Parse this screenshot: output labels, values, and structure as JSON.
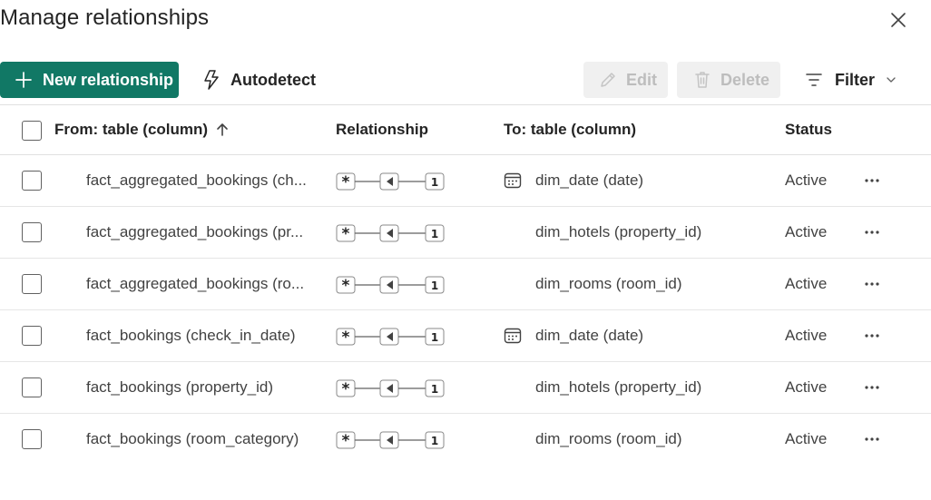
{
  "dialog": {
    "title": "Manage relationships",
    "close_icon": "close-icon"
  },
  "toolbar": {
    "new_relationship": "New relationship",
    "autodetect": "Autodetect",
    "edit": "Edit",
    "delete": "Delete",
    "filter": "Filter",
    "accent_color": "#117865",
    "disabled_bg": "#f0f0f0",
    "disabled_text": "#bdbdbd"
  },
  "table": {
    "headers": {
      "from": "From: table (column)",
      "relationship": "Relationship",
      "to": "To: table (column)",
      "status": "Status"
    },
    "sort": {
      "column": "from",
      "direction": "ascending"
    },
    "cardinality": {
      "from": "*",
      "to": "1"
    },
    "rows": [
      {
        "from": "fact_aggregated_bookings (ch...",
        "to": "dim_date (date)",
        "to_icon": "calendar-icon",
        "status": "Active"
      },
      {
        "from": "fact_aggregated_bookings (pr...",
        "to": "dim_hotels (property_id)",
        "to_icon": "",
        "status": "Active"
      },
      {
        "from": "fact_aggregated_bookings (ro...",
        "to": "dim_rooms (room_id)",
        "to_icon": "",
        "status": "Active"
      },
      {
        "from": "fact_bookings (check_in_date)",
        "to": "dim_date (date)",
        "to_icon": "calendar-icon",
        "status": "Active"
      },
      {
        "from": "fact_bookings (property_id)",
        "to": "dim_hotels (property_id)",
        "to_icon": "",
        "status": "Active"
      },
      {
        "from": "fact_bookings (room_category)",
        "to": "dim_rooms (room_id)",
        "to_icon": "",
        "status": "Active"
      }
    ]
  }
}
